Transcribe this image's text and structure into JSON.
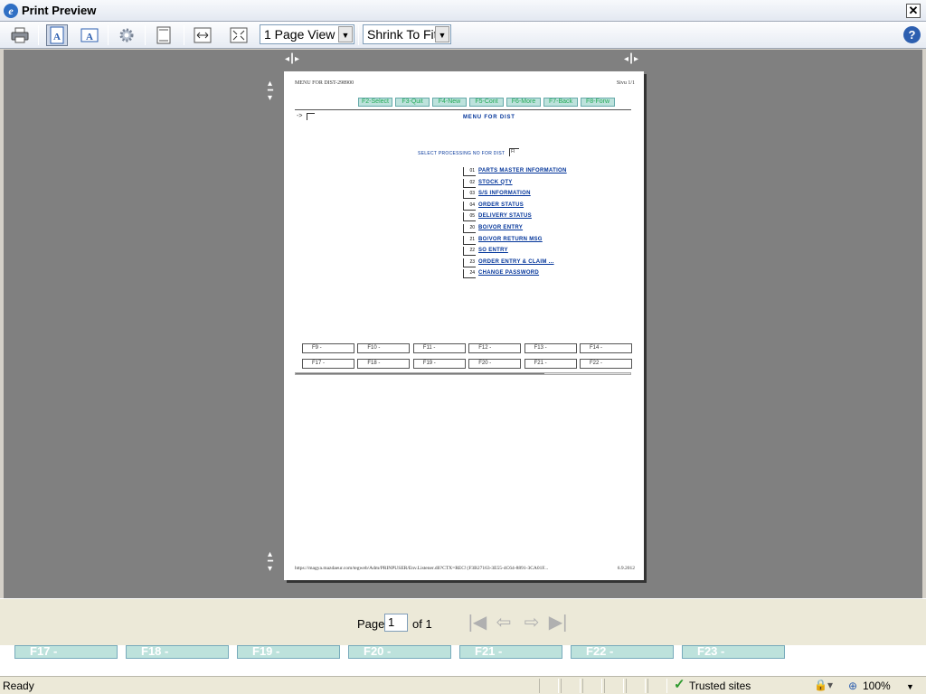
{
  "window": {
    "title": "Print Preview",
    "app_icon": "ie-icon"
  },
  "toolbar": {
    "view_select_value": "1 Page View",
    "fit_select_value": "Shrink To Fit"
  },
  "document": {
    "header_left": "MENU FOR DIST-298900",
    "header_right": "Sivu 1/1",
    "fkeys_top": [
      "F2-Select",
      "F3-Quit",
      "F4-New",
      "F5-Cont",
      "F6-More",
      "F7-Back",
      "F8-Forw"
    ],
    "arrow_prompt": "->",
    "menu_title": "MENU FOR DIST",
    "select_label": "SELECT PROCESSING NO FOR DIST",
    "select_value": "FI",
    "menu_items": [
      {
        "num": "01",
        "label": "PARTS MASTER INFORMATION"
      },
      {
        "num": "02",
        "label": "STOCK QTY"
      },
      {
        "num": "03",
        "label": "S/S INFORMATION"
      },
      {
        "num": "04",
        "label": "ORDER STATUS"
      },
      {
        "num": "05",
        "label": "DELIVERY STATUS"
      },
      {
        "num": "20",
        "label": "BO/VOR ENTRY"
      },
      {
        "num": "21",
        "label": "BO/VOR RETURN MSG"
      },
      {
        "num": "22",
        "label": "SO ENTRY"
      },
      {
        "num": "23",
        "label": "ORDER ENTRY & CLAIM ..."
      },
      {
        "num": "24",
        "label": "CHANGE PASSWORD"
      }
    ],
    "fkeys_row1": [
      "F9 -",
      "F10 -",
      "F11 -",
      "F12 -",
      "F13 -",
      "F14 -"
    ],
    "fkeys_row2": [
      "F17 -",
      "F18 -",
      "F19 -",
      "F20 -",
      "F21 -",
      "F22 -"
    ],
    "footer_url": "https://magya.mazdaeur.com/tegweb/Adm/PRINPUSER/Env.Listener.dll?CTX=REC!{F3B27163-3E55-4C64-8891-3CA01F...",
    "footer_date": "6.9.2012"
  },
  "pager": {
    "page_label": "Page",
    "page_value": "1",
    "of_label": "of 1"
  },
  "background_fkeys": [
    "F17 -",
    "F18 -",
    "F19 -",
    "F20 -",
    "F21 -",
    "F22 -",
    "F23 -"
  ],
  "status": {
    "text": "Ready",
    "zone": "Trusted sites",
    "zoom": "100%"
  }
}
